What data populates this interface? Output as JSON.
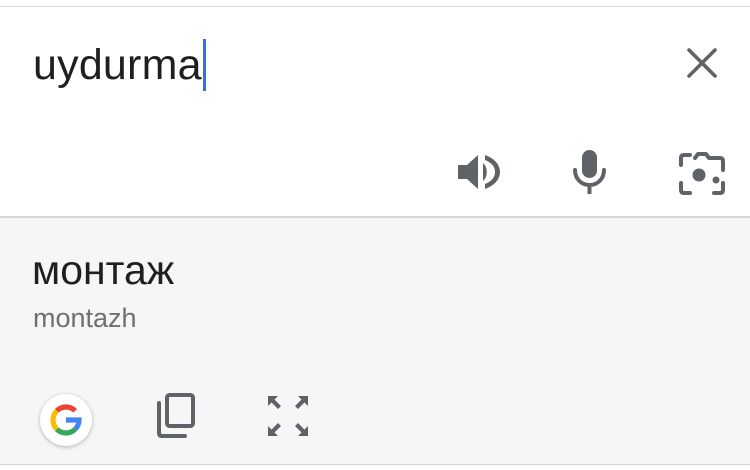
{
  "source": {
    "text": "uydurma"
  },
  "result": {
    "translation": "монтаж",
    "transliteration": "montazh"
  },
  "icons": {
    "clear": "close-icon",
    "listen": "speaker-icon",
    "voice": "microphone-icon",
    "camera": "camera-lens-icon",
    "google": "google-logo-icon",
    "copy": "copy-icon",
    "fullscreen": "fullscreen-icon"
  },
  "colors": {
    "caret": "#3b6fd8",
    "icon": "#5f6368",
    "output_background": "#f6f6f7"
  }
}
